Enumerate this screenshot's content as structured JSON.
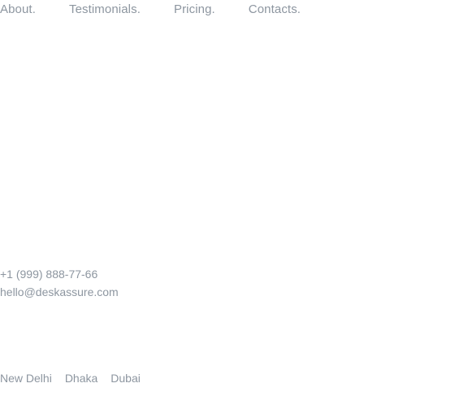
{
  "nav": {
    "items": [
      {
        "label": "About."
      },
      {
        "label": "Testimonials."
      },
      {
        "label": "Pricing."
      },
      {
        "label": "Contacts."
      }
    ]
  },
  "contact": {
    "phone": "+1 (999) 888-77-66",
    "email": "hello@deskassure.com"
  },
  "locations": [
    "New Delhi",
    "Dhaka",
    "Dubai"
  ],
  "colors": {
    "text": "#8d96a0",
    "background": "#ffffff"
  }
}
